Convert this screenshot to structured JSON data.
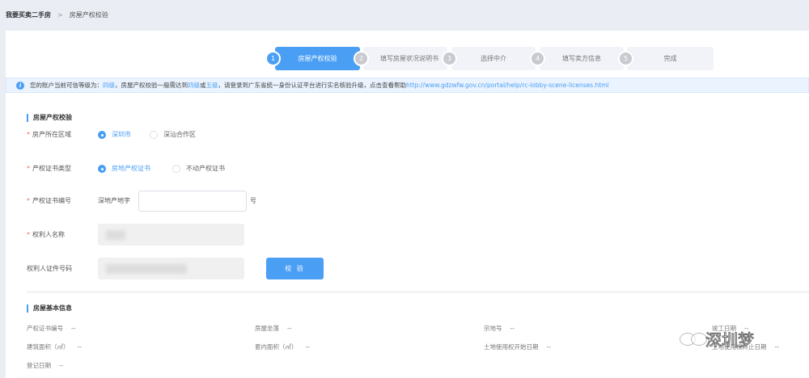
{
  "breadcrumb": {
    "parent": "我要买卖二手房",
    "separator": ">",
    "current": "房屋产权校验"
  },
  "steps": [
    {
      "num": "1",
      "label": "房屋产权校验"
    },
    {
      "num": "2",
      "label": "填写房屋状况说明书"
    },
    {
      "num": "3",
      "label": "选择中介"
    },
    {
      "num": "4",
      "label": "填写卖方信息"
    },
    {
      "num": "5",
      "label": "完成"
    }
  ],
  "notice": {
    "p1": "您的账户当前可信等级为：",
    "level": "四级",
    "p2": "，房屋产权校验一般需达到",
    "l4": "四级",
    "or": "或",
    "l5": "五级",
    "p3": "，请登录到广东省统一身份认证平台进行实名核验升级，点击查看帮助 ",
    "link": "http://www.gdzwfw.gov.cn/portal/help/rc-lobby-scene-licenses.html"
  },
  "form": {
    "title": "房屋产权校验",
    "region_label": "房产所在区域",
    "region_opts": [
      "深圳市",
      "深汕合作区"
    ],
    "cert_type_label": "产权证书类型",
    "cert_type_opts": [
      "房地产权证书",
      "不动产权证书"
    ],
    "cert_no_label": "产权证书编号",
    "cert_prefix": "深地产地字",
    "cert_suffix": "号",
    "cert_no_value": "",
    "owner_label": "权利人名称",
    "owner_id_label": "权利人证件号码",
    "verify_button": "校 验"
  },
  "basic": {
    "title": "房屋基本信息",
    "fields": [
      {
        "label": "产权证书编号",
        "value": "--"
      },
      {
        "label": "房屋坐落",
        "value": "--"
      },
      {
        "label": "宗地号",
        "value": "--"
      },
      {
        "label": "竣工日期",
        "value": "--"
      },
      {
        "label": "建筑面积（㎡）",
        "value": "--"
      },
      {
        "label": "套内面积（㎡）",
        "value": "--"
      },
      {
        "label": "土地使用权开始日期",
        "value": "--"
      },
      {
        "label": "土地使用权终止日期",
        "value": "--"
      },
      {
        "label": "登记日期",
        "value": "--"
      }
    ]
  },
  "watermark": "深圳梦"
}
